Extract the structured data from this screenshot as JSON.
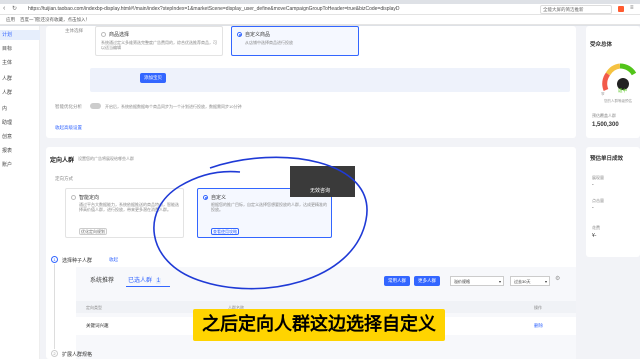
{
  "browser": {
    "tab_title": "首页",
    "url": "https://tuijian.taobao.com/indexbp-display.html#!/main/index?stepIndex=1&marketScene=display_user_define&moveCampaignGroupToHeader=true&bizCode=displayD",
    "security_label": "不安全",
    "search_box": "全能大屏的简洁推新",
    "bookmarks": [
      "应用",
      "百度一下",
      "您还没有收藏，点击加入！"
    ]
  },
  "sidebar": {
    "items": [
      "计划",
      "目标",
      "主体",
      "人群",
      "人群",
      "内",
      "助理",
      "创意",
      "报表",
      "账户"
    ]
  },
  "top_section": {
    "label": "主体选择",
    "card1_title": "商品选择",
    "card1_desc": "系统通过定义多维筛选完整度广告费用的，综合优选推荐商品，可以适当编辑",
    "card2_title": "自定义商品",
    "card2_desc": "从店铺中选择商品进行投放",
    "add_button": "添加宝贝",
    "smart_label": "智能优化分析",
    "smart_desc": "开启后，系统依据数据每个商品同步为一个计划进行投放，数据需同步10分钟",
    "collapse_link": "收起高级设置"
  },
  "targeting": {
    "title": "定向人群",
    "subtitle": "设置您的广告将展现给哪些人群",
    "mode_label": "定向方式",
    "card_smart_title": "智能定向",
    "card_smart_desc": "通过平台大数据能力，系统依据推送的商品特点，智能选择高价值人群，进行投放，带来更多潜在消费人群。",
    "card_smart_btn": "优化定向规划",
    "card_custom_title": "自定义",
    "card_custom_desc": "根据您的推广目标，自定义选择您想要投放的人群，达成更精准的投放。",
    "card_custom_btn": "查看使用攻略",
    "tooltip": "无效咨询",
    "step1_label": "选择种子人群",
    "step1_link": "收起",
    "tab_recommended": "系统推荐",
    "tab_selected": "已选人群",
    "tab_selected_count": "1",
    "btn_common": "常用人群",
    "btn_more": "更多人群",
    "select1": "溢价规格",
    "select2": "过去30天",
    "col_name": "定向类型",
    "col_crowd": "人群名称",
    "col_op": "操作",
    "row_name": "关键词兴趣",
    "row_op": "删除",
    "step2_label": "扩展人群规格"
  },
  "right_panel": {
    "gauge_title": "受众总体",
    "gauge_status": "适中",
    "gauge_scale_left": "窄",
    "gauge_scale_right": "宽",
    "gauge_sub": "您的人群等级预估",
    "audience_label": "预估覆盖人群",
    "audience_value": "1,500,300",
    "daily_title": "预估单日成效",
    "metric1": "展现量",
    "metric1_val": "-",
    "metric2": "点击量",
    "metric2_val": "-",
    "metric3": "花费",
    "metric3_val": "¥-"
  },
  "caption": "之后定向人群这边选择自定义"
}
